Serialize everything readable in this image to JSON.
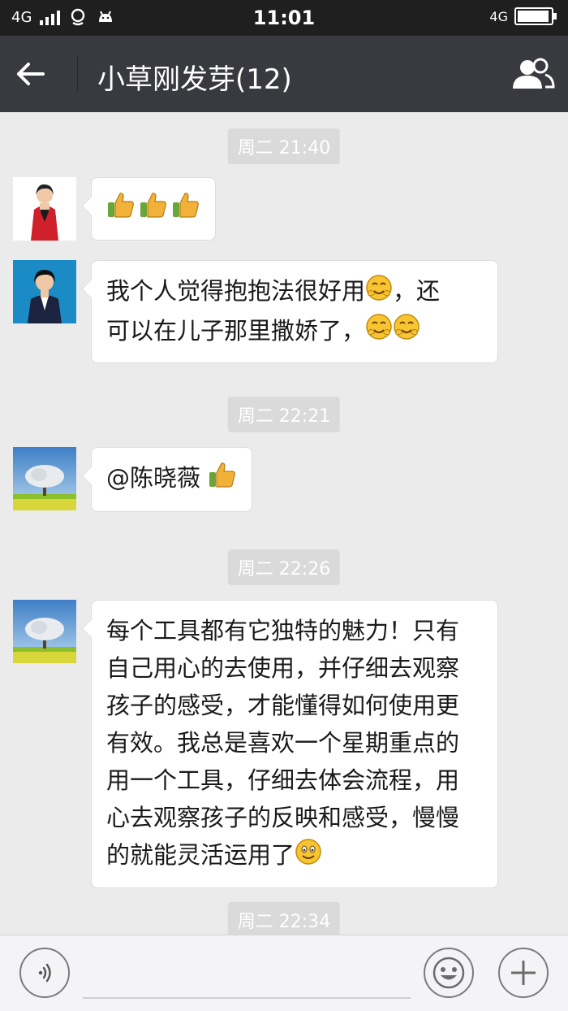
{
  "status_bar": {
    "network_left": "4G",
    "time": "11:01",
    "network_right": "4G",
    "battery_level": 0.95
  },
  "header": {
    "title": "小草刚发芽(12)"
  },
  "messages": [
    {
      "type": "time",
      "text": "周二 21:40"
    },
    {
      "type": "msg",
      "avatar": "avatar-red-jacket-woman",
      "text": "",
      "emojis": [
        "thumbs-up-icon",
        "thumbs-up-icon",
        "thumbs-up-icon"
      ]
    },
    {
      "type": "msg",
      "avatar": "avatar-woman-suit",
      "lines": [
        "我个人觉得抱抱法很好用",
        "，还",
        "可以在儿子那里撒娇了，"
      ],
      "emojis": [
        "hug-emoji-icon",
        "hug-emoji-icon",
        "hug-emoji-icon"
      ]
    },
    {
      "type": "time",
      "text": "周二 22:21"
    },
    {
      "type": "msg",
      "avatar": "avatar-tree-landscape",
      "text": "@陈晓薇",
      "emojis": [
        "thumbs-up-icon"
      ]
    },
    {
      "type": "time",
      "text": "周二 22:26"
    },
    {
      "type": "msg",
      "avatar": "avatar-tree-landscape",
      "lines": [
        "每个工具都有它独特的魅力！只有",
        "自己用心的去使用，并仔细去观察",
        "孩子的感受，才能懂得如何使用更",
        "有效。我总是喜欢一个星期重点的",
        "用一个工具，仔细去体会流程，用",
        "心去观察孩子的反映和感受，慢慢",
        "的就能灵活运用了"
      ],
      "emojis": [
        "smile-emoji-icon"
      ]
    },
    {
      "type": "time",
      "text": "周二 22:34"
    }
  ],
  "m2": {
    "line1": "我个人觉得抱抱法很好用",
    "line1_tail": "，还",
    "line2": "可以在儿子那里撒娇了，"
  },
  "m3": {
    "text": "@陈晓薇"
  },
  "m4": {
    "lines": [
      "每个工具都有它独特的魅力！只有",
      "自己用心的去使用，并仔细去观察",
      "孩子的感受，才能懂得如何使用更",
      "有效。我总是喜欢一个星期重点的",
      "用一个工具，仔细去体会流程，用",
      "心去观察孩子的反映和感受，慢慢",
      "的就能灵活运用了"
    ]
  },
  "times": [
    "周二 21:40",
    "周二 22:21",
    "周二 22:26",
    "周二 22:34"
  ],
  "input_bar": {
    "voice_icon": "voice-icon",
    "emoji_icon": "emoji-icon",
    "plus_icon": "plus-icon",
    "input_value": ""
  },
  "colors": {
    "status_bg": "#1f1f1f",
    "header_bg": "#393a3f",
    "chat_bg": "#ebebeb",
    "bubble_bg": "#ffffff"
  }
}
